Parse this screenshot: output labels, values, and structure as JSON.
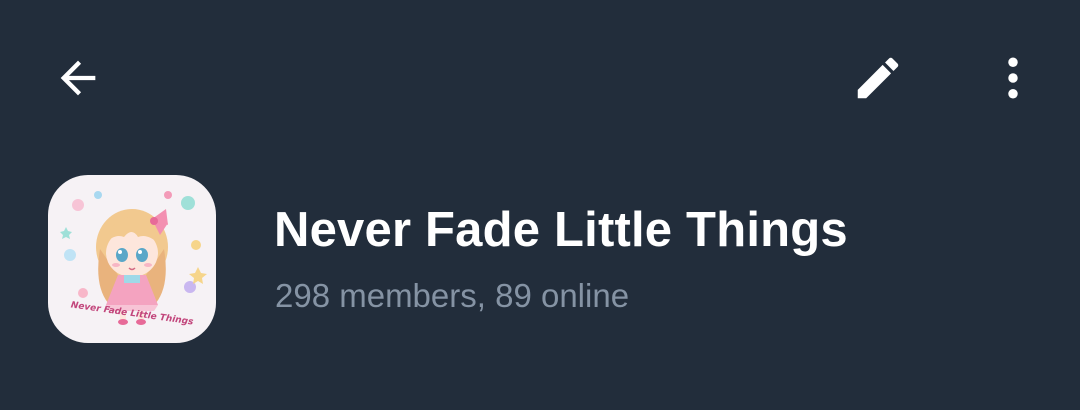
{
  "header": {
    "back_icon": "arrow-left-icon",
    "edit_icon": "pencil-icon",
    "more_icon": "more-vertical-icon",
    "icon_color": "#ffffff",
    "background": "#222d3b"
  },
  "group": {
    "name": "Never Fade Little Things",
    "status": "298 members, 89 online",
    "avatar_caption": "Never Fade Little Things",
    "name_color": "#ffffff",
    "status_color": "#8593a4"
  }
}
